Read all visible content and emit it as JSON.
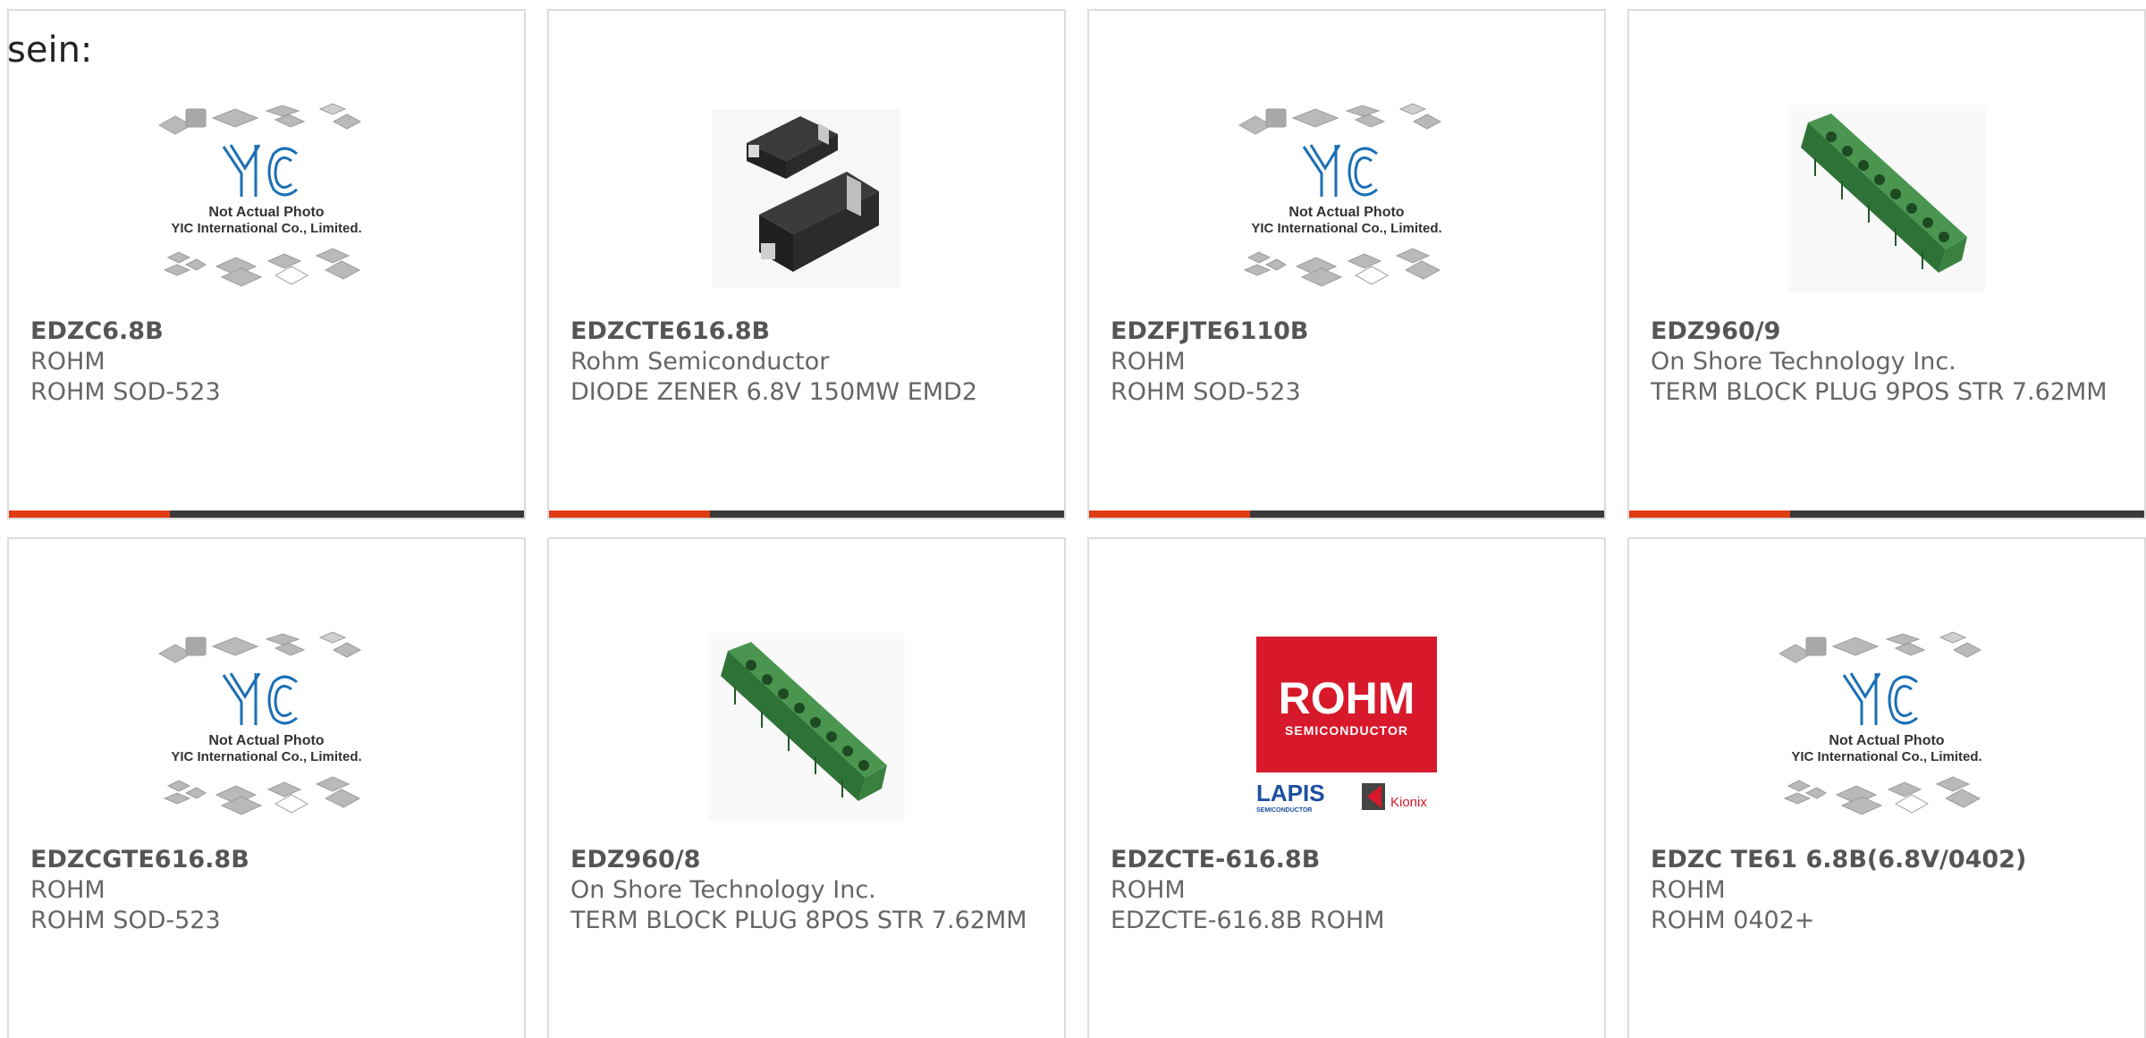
{
  "intro_text": "sein:",
  "placeholder_caption": {
    "line1": "Not Actual Photo",
    "line2": "YIC International Co., Limited.",
    "logo": "YIC"
  },
  "rohm_logo": {
    "brand": "ROHM",
    "sub": "SEMICONDUCTOR",
    "lapis": "LAPIS",
    "lapis_sub": "SEMICONDUCTOR",
    "kionix": "Kionix"
  },
  "colors": {
    "accent": "#e03c14",
    "bar": "#3a3a3a",
    "yic_blue": "#1b6fb5",
    "rohm_red": "#d7192b",
    "terminal_green": "#3f8a45"
  },
  "products": [
    {
      "part": "EDZC6.8B",
      "maker": "ROHM",
      "desc": "ROHM SOD-523",
      "image": "placeholder"
    },
    {
      "part": "EDZCTE616.8B",
      "maker": "Rohm Semiconductor",
      "desc": "DIODE ZENER 6.8V 150MW EMD2",
      "image": "diode"
    },
    {
      "part": "EDZFJTE6110B",
      "maker": "ROHM",
      "desc": "ROHM SOD-523",
      "image": "placeholder"
    },
    {
      "part": "EDZ960/9",
      "maker": "On Shore Technology Inc.",
      "desc": "TERM BLOCK PLUG 9POS STR 7.62MM",
      "image": "terminal"
    },
    {
      "part": "EDZCGTE616.8B",
      "maker": "ROHM",
      "desc": "ROHM SOD-523",
      "image": "placeholder"
    },
    {
      "part": "EDZ960/8",
      "maker": "On Shore Technology Inc.",
      "desc": "TERM BLOCK PLUG 8POS STR 7.62MM",
      "image": "terminal"
    },
    {
      "part": "EDZCTE-616.8B",
      "maker": "ROHM",
      "desc": "EDZCTE-616.8B ROHM",
      "image": "rohm"
    },
    {
      "part": "EDZC TE61 6.8B(6.8V/0402)",
      "maker": "ROHM",
      "desc": "ROHM 0402+",
      "image": "placeholder"
    }
  ]
}
